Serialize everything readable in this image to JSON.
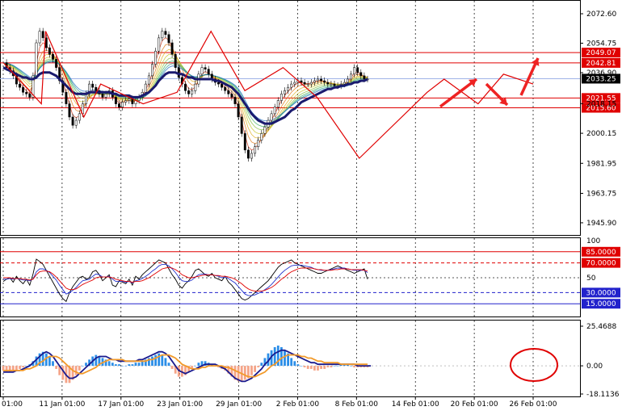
{
  "chart_data": [
    {
      "type": "line",
      "panel": "price",
      "title": "",
      "xlabel": "",
      "ylabel": "",
      "ylim": [
        1940,
        2080
      ],
      "y_ticks": [
        "2072.60",
        "2054.75",
        "2036.90",
        "2018.15",
        "2000.15",
        "1981.95",
        "1963.75",
        "1945.90"
      ],
      "y_tick_values": [
        2072.6,
        2054.75,
        2036.9,
        2018.15,
        2000.15,
        1981.95,
        1963.75,
        1945.9
      ],
      "levels": [
        {
          "label": "2049.07",
          "value": 2049.07,
          "color": "#e00000"
        },
        {
          "label": "2042.81",
          "value": 2042.81,
          "color": "#e00000"
        },
        {
          "label": "2021.55",
          "value": 2021.55,
          "color": "#e00000"
        },
        {
          "label": "2015.60",
          "value": 2015.6,
          "color": "#e00000"
        }
      ],
      "current_price": {
        "label": "2033.25",
        "value": 2033.25
      },
      "x": [
        0,
        2,
        4,
        6,
        8,
        10,
        12,
        14,
        16,
        18,
        20,
        22,
        24,
        26,
        28,
        30,
        32,
        34,
        36,
        38,
        40,
        42,
        44,
        46,
        48,
        50,
        52,
        54,
        56,
        58,
        60,
        62,
        64,
        66,
        68,
        70,
        72,
        74,
        76,
        78,
        80,
        82,
        84,
        86,
        88,
        90,
        92,
        94,
        96,
        98,
        100,
        102,
        104,
        106,
        108,
        110,
        112,
        114,
        116,
        118,
        120,
        122,
        124,
        126,
        128,
        130,
        132,
        134,
        136,
        138,
        140,
        142,
        144,
        146,
        148,
        150,
        152,
        154,
        156,
        158,
        160,
        162,
        164,
        166,
        168,
        170,
        172,
        174,
        176,
        178,
        180,
        182,
        184,
        186,
        188,
        190,
        192,
        194,
        196,
        198,
        200,
        202,
        204,
        206,
        208,
        210,
        212,
        214,
        216,
        218,
        220,
        222,
        224,
        226,
        228,
        230,
        232,
        234,
        236,
        238,
        240,
        242,
        244,
        246,
        248,
        250,
        252,
        254,
        256,
        258,
        260,
        262,
        264,
        266,
        268,
        270,
        272,
        274,
        276,
        278,
        280,
        282,
        284,
        286,
        288,
        290,
        292,
        294,
        296,
        298,
        300,
        302,
        304,
        306,
        308,
        310,
        312,
        314,
        316,
        318,
        320
      ],
      "series": [
        {
          "values": [
            2043,
            2040,
            2038,
            2035,
            2030,
            2028,
            2025,
            2024,
            2022,
            2035,
            2055,
            2062,
            2058,
            2052,
            2048,
            2045,
            2040,
            2032,
            2025,
            2018,
            2010,
            2005,
            2008,
            2012,
            2018,
            2024,
            2030,
            2028,
            2026,
            2024,
            2022,
            2024,
            2026,
            2022,
            2018,
            2016,
            2019,
            2020,
            2021,
            2018,
            2020,
            2022,
            2025,
            2030,
            2035,
            2042,
            2050,
            2058,
            2062,
            2060,
            2055,
            2048,
            2040,
            2034,
            2030,
            2026,
            2024,
            2026,
            2030,
            2036,
            2040,
            2039,
            2036,
            2033,
            2031,
            2030,
            2028,
            2026,
            2024,
            2022,
            2018,
            2010,
            2000,
            1990,
            1985,
            1988,
            1992,
            1996,
            2000,
            2004,
            2008,
            2012,
            2016,
            2020,
            2024,
            2026,
            2028,
            2030,
            2031,
            2032,
            2031,
            2030,
            2030,
            2031,
            2032,
            2033,
            2032,
            2031,
            2030,
            2030,
            2029,
            2029,
            2030,
            2031,
            2033,
            2036,
            2040,
            2037,
            2035,
            2033,
            2033
          ],
          "color": "#000000"
        },
        {
          "name": "",
          "values": [
            2040,
            2039,
            2038,
            2037,
            2036,
            2035,
            2034,
            2034,
            2033,
            2033,
            2034,
            2036,
            2037,
            2037,
            2037,
            2036,
            2035,
            2033,
            2031,
            2029,
            2027,
            2025,
            2024,
            2024,
            2024,
            2024,
            2025,
            2025,
            2025,
            2025,
            2025,
            2025,
            2025,
            2024,
            2024,
            2023,
            2023,
            2023,
            2023,
            2022,
            2022,
            2022,
            2023,
            2024,
            2025,
            2027,
            2029,
            2032,
            2034,
            2036,
            2037,
            2037,
            2037,
            2036,
            2036,
            2035,
            2034,
            2034,
            2033,
            2033,
            2033,
            2033,
            2033,
            2033,
            2032,
            2032,
            2031,
            2030,
            2029,
            2028,
            2026,
            2024,
            2021,
            2018,
            2015,
            2012,
            2010,
            2008,
            2007,
            2006,
            2006,
            2006,
            2007,
            2008,
            2009,
            2010,
            2012,
            2014,
            2015,
            2017,
            2019,
            2020,
            2021,
            2022,
            2023,
            2024,
            2025,
            2026,
            2027,
            2027,
            2028,
            2028,
            2029,
            2029,
            2030,
            2030,
            2031,
            2031,
            2032,
            2032,
            2033
          ],
          "color": "#1a1a6e"
        }
      ],
      "annotations": [
        "red zigzag swing lines",
        "red arrows up/down/up on right side"
      ]
    },
    {
      "type": "line",
      "panel": "oscillator",
      "ylim": [
        0,
        100
      ],
      "y_ticks": [
        "100",
        "85.0000",
        "70.0000",
        "50",
        "30.0000",
        "15.0000"
      ],
      "y_tick_values": [
        100,
        85,
        70,
        50,
        30,
        15
      ],
      "series": [
        {
          "values": [
            45,
            48,
            50,
            44,
            52,
            46,
            42,
            48,
            40,
            55,
            75,
            72,
            68,
            60,
            52,
            44,
            36,
            28,
            22,
            18,
            30,
            38,
            44,
            50,
            52,
            48,
            50,
            58,
            60,
            54,
            46,
            50,
            54,
            40,
            38,
            46,
            44,
            42,
            48,
            40,
            52,
            48,
            54,
            58,
            62,
            66,
            70,
            74,
            72,
            70,
            62,
            54,
            48,
            40,
            36,
            42,
            46,
            52,
            60,
            62,
            58,
            54,
            52,
            56,
            50,
            48,
            46,
            52,
            44,
            40,
            34,
            28,
            22,
            20,
            22,
            26,
            30,
            34,
            38,
            42,
            46,
            52,
            58,
            64,
            68,
            70,
            72,
            74,
            70,
            68,
            66,
            64,
            62,
            60,
            58,
            56,
            56,
            58,
            60,
            62,
            64,
            66,
            64,
            62,
            60,
            58,
            56,
            58,
            60,
            62,
            48
          ],
          "color": "#000000"
        },
        {
          "values": [
            48,
            48,
            49,
            48,
            49,
            48,
            47,
            47,
            46,
            48,
            58,
            62,
            62,
            60,
            57,
            52,
            47,
            40,
            34,
            28,
            30,
            33,
            37,
            42,
            46,
            47,
            48,
            52,
            55,
            54,
            51,
            51,
            52,
            48,
            45,
            45,
            45,
            44,
            45,
            43,
            46,
            47,
            49,
            52,
            55,
            59,
            62,
            66,
            68,
            68,
            66,
            62,
            57,
            51,
            46,
            45,
            45,
            47,
            51,
            54,
            55,
            55,
            54,
            54,
            53,
            52,
            50,
            51,
            49,
            46,
            43,
            38,
            33,
            28,
            26,
            26,
            27,
            29,
            31,
            34,
            37,
            41,
            46,
            51,
            56,
            60,
            63,
            66,
            67,
            67,
            67,
            66,
            65,
            64,
            62,
            61,
            60,
            60,
            60,
            61,
            62,
            63,
            63,
            63,
            62,
            61,
            60,
            60,
            60,
            60,
            57
          ],
          "color": "#2233cc"
        },
        {
          "values": [
            50,
            50,
            50,
            49,
            49,
            49,
            48,
            48,
            47,
            48,
            54,
            58,
            59,
            59,
            58,
            55,
            51,
            46,
            41,
            36,
            34,
            34,
            35,
            38,
            41,
            43,
            45,
            47,
            50,
            51,
            51,
            51,
            51,
            50,
            48,
            47,
            46,
            45,
            45,
            44,
            45,
            45,
            46,
            48,
            50,
            53,
            56,
            59,
            62,
            63,
            64,
            63,
            61,
            58,
            54,
            52,
            50,
            50,
            51,
            52,
            53,
            54,
            54,
            54,
            53,
            53,
            52,
            52,
            51,
            50,
            48,
            45,
            42,
            38,
            35,
            33,
            32,
            32,
            32,
            33,
            35,
            37,
            40,
            44,
            48,
            51,
            55,
            58,
            60,
            62,
            63,
            63,
            63,
            63,
            62,
            61,
            61,
            60,
            60,
            60,
            61,
            61,
            62,
            62,
            62,
            61,
            61,
            61,
            61,
            60,
            59
          ],
          "color": "#e00000"
        }
      ]
    },
    {
      "type": "bar",
      "panel": "macd",
      "ylim": [
        -18.1136,
        25.4688
      ],
      "y_ticks": [
        "25.4688",
        "0.00",
        "-18.1136"
      ],
      "y_tick_values": [
        25.4688,
        0,
        -18.1136
      ],
      "histogram": [
        -3,
        -4,
        -4,
        -3,
        -3,
        -2,
        -1,
        0,
        1,
        3,
        6,
        8,
        9,
        8,
        6,
        3,
        -2,
        -6,
        -9,
        -11,
        -11,
        -9,
        -6,
        -3,
        0,
        2,
        4,
        6,
        7,
        6,
        5,
        4,
        3,
        2,
        1,
        1,
        0,
        0,
        1,
        1,
        2,
        2,
        3,
        4,
        5,
        6,
        7,
        8,
        7,
        5,
        2,
        -2,
        -5,
        -7,
        -7,
        -6,
        -4,
        -2,
        0,
        2,
        3,
        3,
        2,
        1,
        0,
        -1,
        -2,
        -3,
        -5,
        -7,
        -9,
        -10,
        -10,
        -9,
        -8,
        -6,
        -4,
        -1,
        2,
        5,
        8,
        10,
        12,
        13,
        12,
        10,
        8,
        5,
        3,
        1,
        0,
        -1,
        -2,
        -2,
        -3,
        -3,
        -2,
        -2,
        -1,
        -1,
        0,
        0,
        1,
        1,
        1,
        0,
        -1,
        -1,
        -1,
        -1,
        -1
      ],
      "histogram_colors": {
        "positive": "#2b8ee8",
        "negative": "#f5a488"
      },
      "series": [
        {
          "values": [
            -4,
            -4,
            -4,
            -4,
            -3,
            -3,
            -2,
            -1,
            0,
            2,
            4,
            6,
            8,
            9,
            8,
            6,
            3,
            0,
            -3,
            -6,
            -8,
            -8,
            -7,
            -5,
            -3,
            -1,
            1,
            3,
            5,
            6,
            6,
            6,
            5,
            4,
            4,
            3,
            3,
            3,
            3,
            3,
            3,
            4,
            4,
            5,
            6,
            7,
            8,
            9,
            9,
            8,
            6,
            3,
            0,
            -3,
            -4,
            -5,
            -4,
            -3,
            -2,
            -1,
            0,
            1,
            1,
            1,
            1,
            0,
            -1,
            -2,
            -4,
            -6,
            -8,
            -9,
            -10,
            -10,
            -9,
            -8,
            -6,
            -4,
            -2,
            1,
            3,
            6,
            8,
            9,
            10,
            10,
            9,
            8,
            7,
            6,
            5,
            4,
            3,
            2,
            2,
            1,
            1,
            1,
            1,
            1,
            1,
            1,
            1,
            1,
            1,
            1,
            1,
            0,
            0,
            0,
            0,
            0
          ],
          "color": "#1a1a8e"
        },
        {
          "values": [
            -3,
            -3,
            -3,
            -3,
            -3,
            -3,
            -3,
            -2,
            -2,
            -1,
            0,
            2,
            3,
            5,
            6,
            6,
            6,
            5,
            3,
            1,
            -1,
            -3,
            -4,
            -5,
            -5,
            -4,
            -3,
            -2,
            -1,
            1,
            2,
            3,
            4,
            4,
            4,
            4,
            4,
            3,
            3,
            3,
            3,
            3,
            3,
            3,
            4,
            4,
            5,
            6,
            7,
            7,
            7,
            6,
            5,
            3,
            1,
            0,
            -1,
            -2,
            -2,
            -2,
            -1,
            -1,
            0,
            0,
            0,
            0,
            0,
            -1,
            -1,
            -2,
            -3,
            -4,
            -5,
            -6,
            -7,
            -7,
            -7,
            -6,
            -5,
            -4,
            -2,
            0,
            1,
            3,
            5,
            6,
            7,
            7,
            7,
            7,
            6,
            6,
            5,
            5,
            4,
            3,
            3,
            2,
            2,
            2,
            2,
            2,
            1,
            1,
            1,
            1,
            1,
            1,
            1,
            1,
            1
          ],
          "color": "#f29a2a"
        }
      ],
      "annotations": [
        "red circle around latest MACD values"
      ]
    }
  ],
  "x_axis_labels": [
    "01:00",
    "11 Jan 01:00",
    "17 Jan 01:00",
    "23 Jan 01:00",
    "29 Jan 01:00",
    "2 Feb 01:00",
    "8 Feb 01:00",
    "14 Feb 01:00",
    "20 Feb 01:00",
    "26 Feb 01:00"
  ],
  "x_axis_positions": [
    0,
    27,
    54,
    81,
    108,
    135,
    162,
    189,
    216,
    243
  ],
  "colors": {
    "resistance": "#e00000",
    "current_price_line": "#9fb3e8",
    "ribbon": [
      "#d03a1a",
      "#e07a1a",
      "#e0b020",
      "#c8c830",
      "#88c040",
      "#40b060",
      "#30a090",
      "#2070c0"
    ]
  }
}
